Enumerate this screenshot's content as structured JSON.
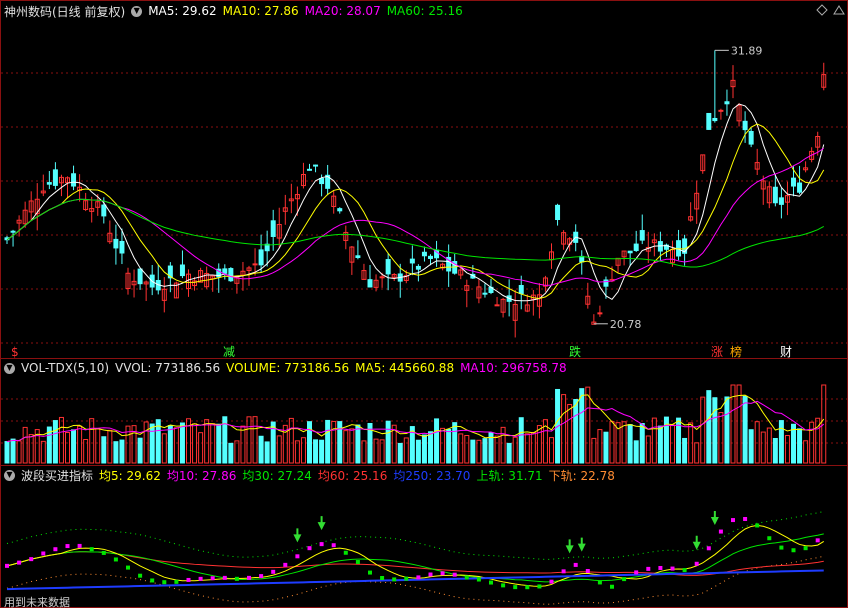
{
  "price_header": {
    "title": "神州数码(日线 前复权)",
    "ma5": "MA5: 29.62",
    "ma10": "MA10: 27.86",
    "ma20": "MA20: 28.07",
    "ma60": "MA60: 25.16"
  },
  "vol_header": {
    "title": "VOL-TDX(5,10)",
    "vvol": "VVOL: 773186.56",
    "volume": "VOLUME: 773186.56",
    "ma5": "MA5: 445660.88",
    "ma10": "MA10: 296758.78"
  },
  "ind_header": {
    "title": "波段买进指标",
    "j5": "均5: 29.62",
    "j10": "均10: 27.86",
    "j30": "均30: 27.24",
    "j60": "均60: 25.16",
    "j250": "均250: 23.70",
    "up": "上轨: 31.71",
    "down": "下轨: 22.78"
  },
  "footer_text": "用到未来数据",
  "colors": {
    "up": "#ff3232",
    "down": "#54ffff",
    "ma5": "#ffffff",
    "ma10": "#ffff00",
    "ma20": "#ff00ff",
    "ma60": "#00e600",
    "grid": "#8a1010",
    "j250": "#1e3cff"
  },
  "chart_data": [
    {
      "type": "candlestick",
      "annotations": [
        {
          "text": "31.89",
          "kind": "max-label"
        },
        {
          "text": "20.78",
          "kind": "min-label"
        }
      ],
      "markers": [
        {
          "text": "$",
          "color": "#ff3232"
        },
        {
          "text": "减",
          "color": "#33ff33"
        },
        {
          "text": "跌",
          "color": "#33ff33"
        },
        {
          "text": "涨",
          "color": "#ff3232"
        },
        {
          "text": "榜",
          "color": "#ffaa00"
        },
        {
          "text": "财",
          "color": "#ffffff"
        }
      ],
      "ylim": [
        20.0,
        33.0
      ],
      "series": [
        {
          "name": "MA5",
          "key": "ma5"
        },
        {
          "name": "MA10",
          "key": "ma10"
        },
        {
          "name": "MA20",
          "key": "ma20"
        },
        {
          "name": "MA60",
          "key": "ma60"
        }
      ]
    },
    {
      "type": "bar",
      "series": [
        {
          "name": "MA5"
        },
        {
          "name": "MA10"
        }
      ]
    },
    {
      "type": "line",
      "series": [
        {
          "name": "均5"
        },
        {
          "name": "均10"
        },
        {
          "name": "均30"
        },
        {
          "name": "均60"
        },
        {
          "name": "均250"
        },
        {
          "name": "上轨"
        },
        {
          "name": "下轨"
        }
      ]
    }
  ]
}
